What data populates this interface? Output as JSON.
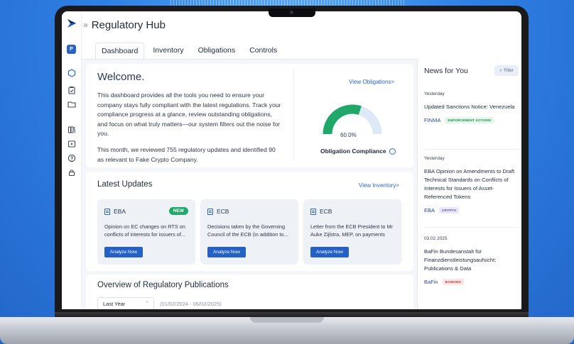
{
  "app": {
    "title": "Regulatory Hub",
    "breadcrumb_glyph": "»",
    "avatar_initial": "P"
  },
  "tabs": [
    {
      "label": "Dashboard",
      "active": true
    },
    {
      "label": "Inventory",
      "active": false
    },
    {
      "label": "Obligations",
      "active": false
    },
    {
      "label": "Controls",
      "active": false
    }
  ],
  "welcome": {
    "title": "Welcome.",
    "paragraph1": "This dashboard provides all the tools you need to ensure your company stays fully compliant with the latest regulations. Track your compliance progress at a glance, review outstanding obligations, and focus on what truly matters—our system filters out the noise for you.",
    "paragraph2": "This month, we reviewed 755 regulatory updates and identified 90 as relevant to Fake Crypto Company.",
    "view_obligations": "View Obligations>",
    "gauge_value": "60.0%",
    "gauge_fraction": 0.6,
    "gauge_label": "Obligation Compliance"
  },
  "latest_updates": {
    "title": "Latest Updates",
    "link": "View Inventory>",
    "items": [
      {
        "source": "EBA",
        "badge": "NEW",
        "text": "Opinion on EC changes on RTS on conflicts of interests for issuers of...",
        "button": "Analyze Now"
      },
      {
        "source": "ECB",
        "badge": "",
        "text": "Decisions taken by the Governing Council of the ECB (in addition to...",
        "button": "Analyze Now"
      },
      {
        "source": "ECB",
        "badge": "",
        "text": "Letter from the ECB President to Mr Auke Zijlstra, MEP, on payments",
        "button": "Analyze Now"
      }
    ]
  },
  "overview": {
    "title": "Overview of Regulatory Publications",
    "select_value": "Last Year",
    "range": "(01/02/2024 - 06/02/2025)"
  },
  "news": {
    "title": "News for You",
    "filter_label": "Filter",
    "items": [
      {
        "date": "Yesterday",
        "headline": "Updated Sanctions Notice: Venezuela",
        "source": "FINMA",
        "tag": "ENFORCEMENT ACTIONS",
        "tag_color": "green"
      },
      {
        "date": "Yesterday",
        "headline": "EBA Opinion on Amendments to Draft Technical Standards on Conflicts of Interests for Issuers of Asset-Referenced Tokens",
        "source": "EBA",
        "tag": "CRYPTO",
        "tag_color": "purple"
      },
      {
        "date": "03.02.2025",
        "headline": "BaFin Bundesanstalt für Finanzdienstleistungsaufsicht: Publications & Data",
        "source": "BaFin",
        "tag": "BANKING",
        "tag_color": "red"
      }
    ]
  },
  "colors": {
    "background": "#2f80e4",
    "accent": "#2560c4",
    "gauge_fill": "#1fa86a",
    "gauge_track": "#dde9f7"
  }
}
